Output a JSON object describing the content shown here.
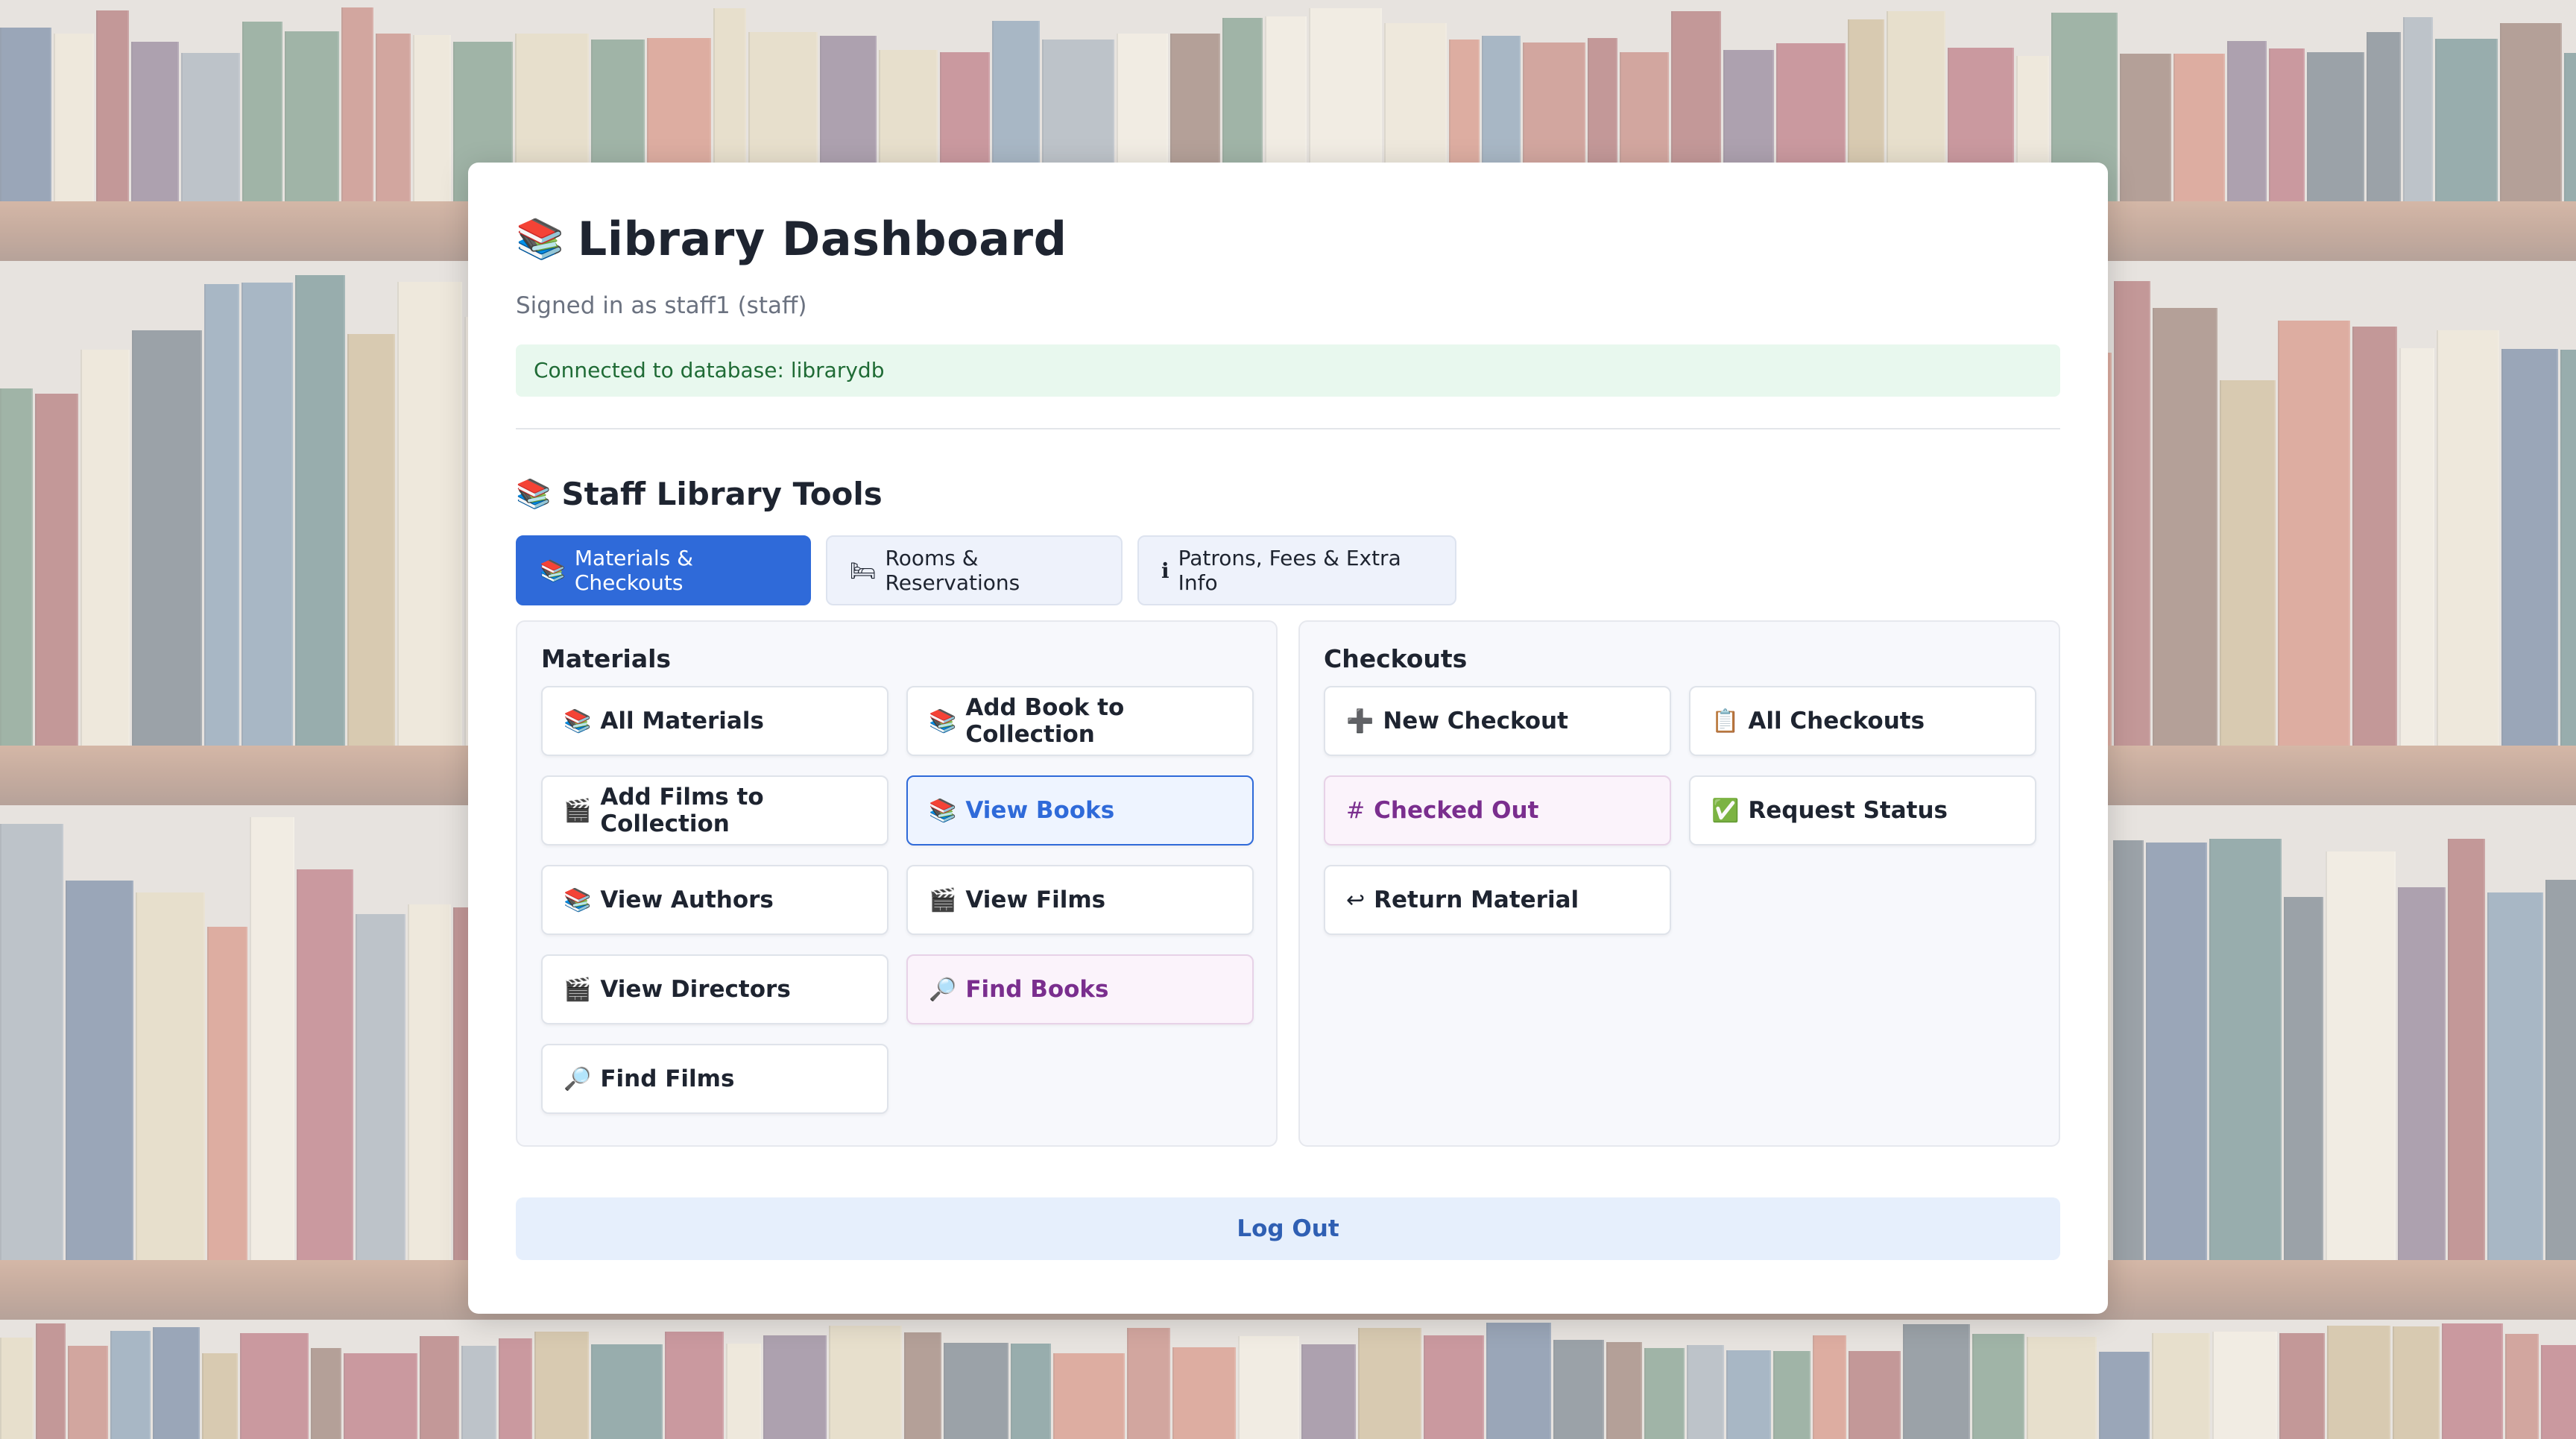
{
  "header": {
    "title_icon": "books-icon",
    "title": "Library Dashboard",
    "signed_in": "Signed in as staff1 (staff)",
    "db_status": "Connected to database: librarydb"
  },
  "tools": {
    "title": "Staff Library Tools",
    "tabs": [
      {
        "icon": "📚",
        "label": "Materials & Checkouts",
        "active": true
      },
      {
        "icon": "🛏",
        "label": "Rooms & Reservations",
        "active": false
      },
      {
        "icon": "ℹ",
        "label": "Patrons, Fees & Extra Info",
        "active": false
      }
    ]
  },
  "materials": {
    "title": "Materials",
    "buttons": [
      {
        "icon": "📚",
        "label": "All Materials"
      },
      {
        "icon": "📚",
        "label": "Add Book to Collection"
      },
      {
        "icon": "🎬",
        "label": "Add Films to Collection"
      },
      {
        "icon": "📚",
        "label": "View Books",
        "state": "selected"
      },
      {
        "icon": "📚",
        "label": "View Authors"
      },
      {
        "icon": "🎬",
        "label": "View Films"
      },
      {
        "icon": "🎬",
        "label": "View Directors"
      },
      {
        "icon": "🔎",
        "label": "Find Books",
        "state": "purple"
      },
      {
        "icon": "🔎",
        "label": "Find Films"
      }
    ]
  },
  "checkouts": {
    "title": "Checkouts",
    "buttons": [
      {
        "icon": "➕",
        "label": "New Checkout"
      },
      {
        "icon": "📋",
        "label": "All Checkouts"
      },
      {
        "icon": "#",
        "label": "Checked Out",
        "state": "purple"
      },
      {
        "icon": "✅",
        "label": "Request Status"
      },
      {
        "icon": "↩",
        "label": "Return Material"
      }
    ]
  },
  "logout_label": "Log Out",
  "colors": {
    "accent": "#2f6ad9",
    "success_bg": "#e8f8ee",
    "success_text": "#1f6b35",
    "purple_text": "#7a2e8e"
  }
}
